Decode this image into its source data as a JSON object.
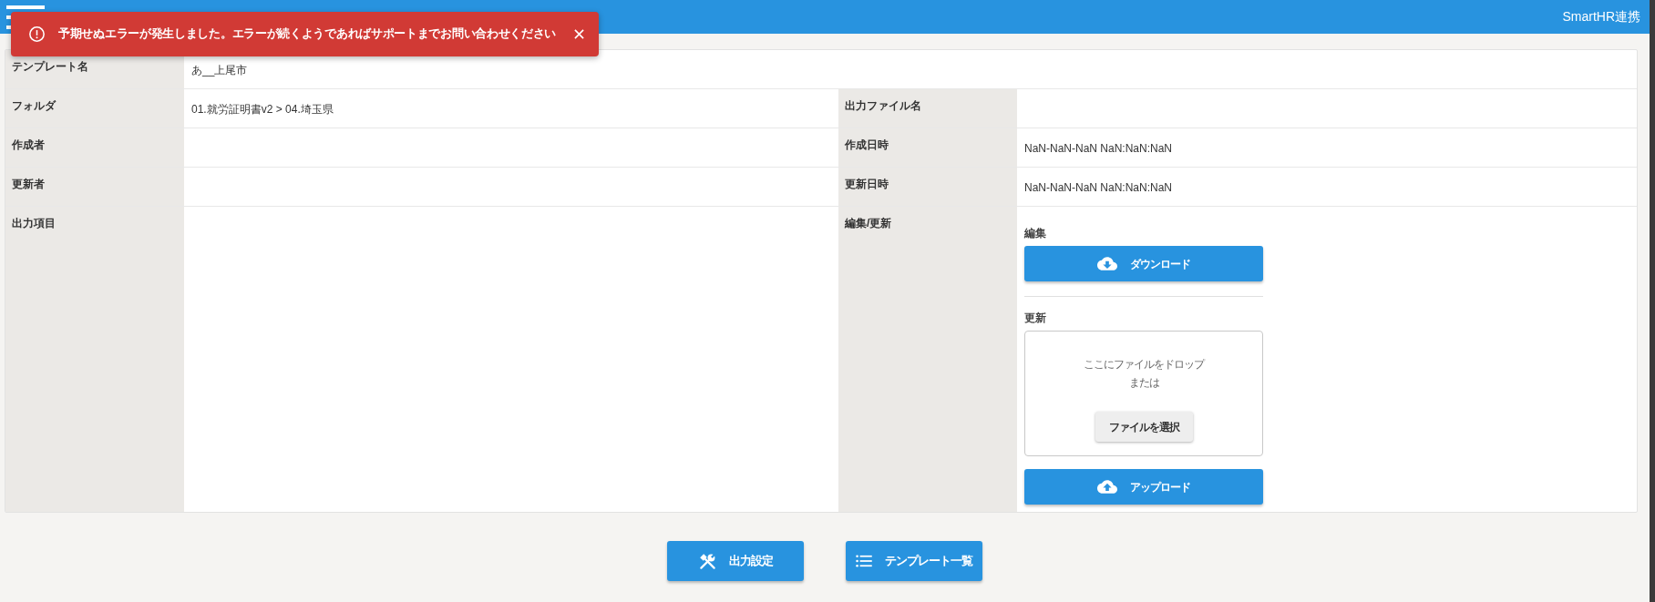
{
  "header": {
    "link": "SmartHR連携"
  },
  "toast": {
    "kind": "error",
    "message": "予期せぬエラーが発生しました。エラーが続くようであればサポートまでお問い合わせください"
  },
  "details": [
    {
      "fields": [
        {
          "kind": "text",
          "label": "テンプレート名",
          "value": "あ__上尾市"
        }
      ]
    },
    {
      "fields": [
        {
          "kind": "text",
          "label": "フォルダ",
          "value": "01.就労証明書v2 > 04.埼玉県"
        },
        {
          "kind": "text",
          "label": "出力ファイル名"
        }
      ]
    },
    {
      "fields": [
        {
          "kind": "text",
          "label": "作成者"
        },
        {
          "kind": "text",
          "label": "作成日時",
          "value": "NaN-NaN-NaN NaN:NaN:NaN"
        }
      ]
    },
    {
      "fields": [
        {
          "kind": "text",
          "label": "更新者"
        },
        {
          "kind": "text",
          "label": "更新日時",
          "value": "NaN-NaN-NaN NaN:NaN:NaN"
        }
      ]
    },
    {
      "fields": [
        {
          "kind": "text",
          "label": "出力項目"
        },
        {
          "kind": "file_actions",
          "label": "編集/更新",
          "edit": {
            "heading": "編集",
            "button": "ダウンロード"
          },
          "update": {
            "heading": "更新",
            "drop_hint": "ここにファイルをドロップ",
            "or_text": "または",
            "select_button": "ファイルを選択",
            "button": "アップロード"
          }
        }
      ]
    }
  ],
  "actions": [
    {
      "kind": "settings",
      "label": "出力設定"
    },
    {
      "kind": "list",
      "label": "テンプレート一覧"
    }
  ]
}
